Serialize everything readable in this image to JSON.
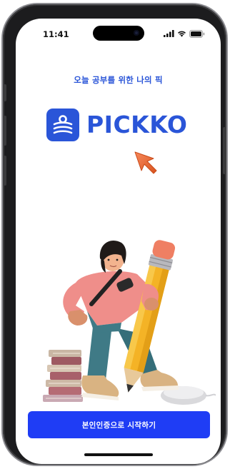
{
  "status_bar": {
    "time": "11:41",
    "icons": [
      "signal-icon",
      "wifi-icon",
      "battery-icon"
    ]
  },
  "brand": {
    "tagline": "오늘 공부를 위한 나의 픽",
    "name": "PICKKO",
    "logo_icon": "pickko-logo-icon",
    "primary_color": "#2a55d8",
    "cursor_color": "#f0703c"
  },
  "hero": {
    "illustration": "student-with-giant-pencil-and-books"
  },
  "cta": {
    "label": "본인인증으로 시작하기",
    "color": "#1f3df5"
  }
}
